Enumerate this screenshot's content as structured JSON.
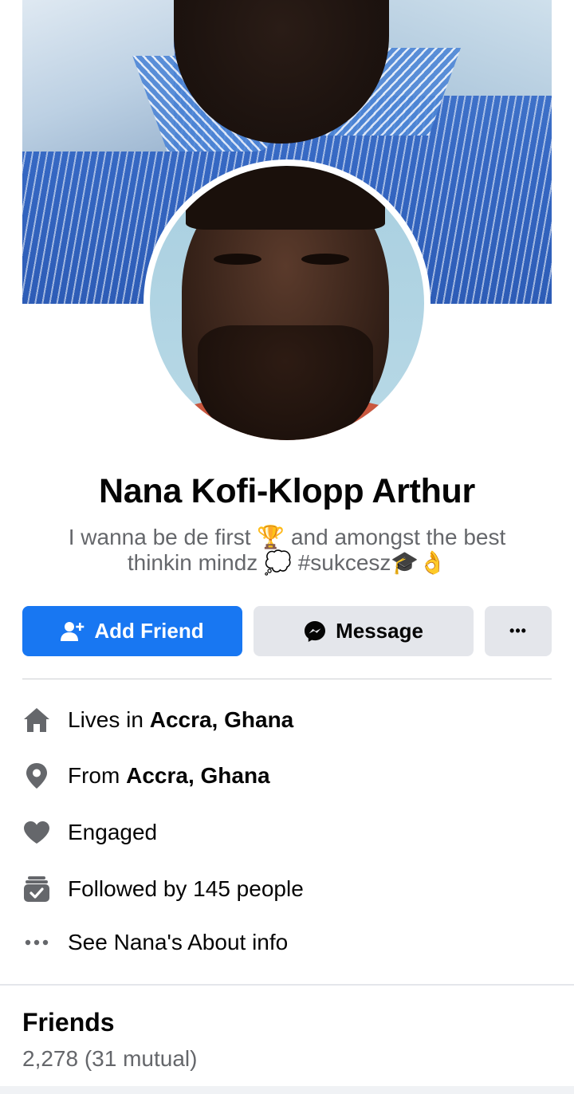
{
  "profile": {
    "name": "Nana Kofi-Klopp Arthur",
    "bio_line1": "I wanna be de first 🏆 and amongst the best",
    "bio_line2": "thinkin mindz 💭 #sukcesz🎓👌"
  },
  "actions": {
    "add_friend_label": "Add Friend",
    "message_label": "Message",
    "more_label": "•••"
  },
  "info": {
    "lives_prefix": "Lives in ",
    "lives_value": "Accra, Ghana",
    "from_prefix": "From ",
    "from_value": "Accra, Ghana",
    "relationship": "Engaged",
    "followers": "Followed by 145 people",
    "about_link": "See Nana's About info"
  },
  "friends": {
    "title": "Friends",
    "count": "2,278 (31 mutual)"
  },
  "colors": {
    "primary_blue": "#1877f2",
    "secondary_button": "#e4e6eb",
    "icon_gray": "#65676b"
  },
  "icons": [
    "add-person-icon",
    "messenger-icon",
    "more-icon",
    "home-icon",
    "location-pin-icon",
    "heart-icon",
    "followers-icon",
    "dots-icon"
  ]
}
